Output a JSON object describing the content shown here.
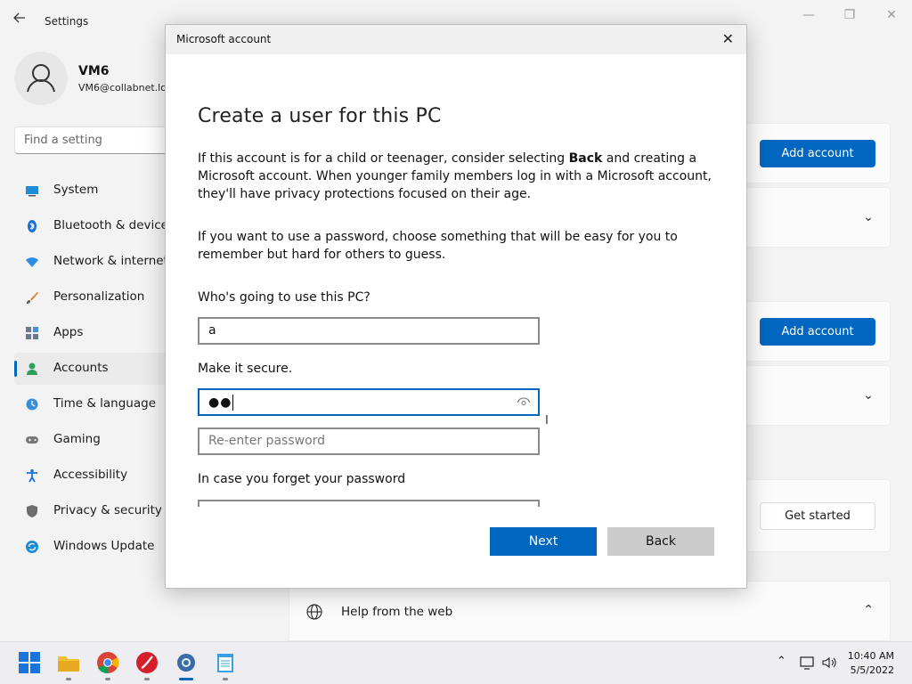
{
  "settings": {
    "title": "Settings",
    "profile": {
      "name": "VM6",
      "email": "VM6@collabnet.lo"
    },
    "search_placeholder": "Find a setting",
    "nav": [
      {
        "label": "System",
        "icon": "system-icon"
      },
      {
        "label": "Bluetooth & devices",
        "icon": "bluetooth-icon"
      },
      {
        "label": "Network & internet",
        "icon": "wifi-icon"
      },
      {
        "label": "Personalization",
        "icon": "brush-icon"
      },
      {
        "label": "Apps",
        "icon": "apps-icon"
      },
      {
        "label": "Accounts",
        "icon": "accounts-icon",
        "active": true
      },
      {
        "label": "Time & language",
        "icon": "clock-icon"
      },
      {
        "label": "Gaming",
        "icon": "gamepad-icon"
      },
      {
        "label": "Accessibility",
        "icon": "accessibility-icon"
      },
      {
        "label": "Privacy & security",
        "icon": "shield-icon"
      },
      {
        "label": "Windows Update",
        "icon": "update-icon"
      }
    ],
    "add_account_label": "Add account",
    "get_started_label": "Get started",
    "help_label": "Help from the web"
  },
  "dialog": {
    "title": "Microsoft account",
    "heading": "Create a user for this PC",
    "para1_before": "If this account is for a child or teenager, consider selecting ",
    "para1_bold": "Back",
    "para1_after": " and creating a Microsoft account. When younger family members log in with a Microsoft account, they'll have privacy protections focused on their age.",
    "para2": "If you want to use a password, choose something that will be easy for you to remember but hard for others to guess.",
    "who_label": "Who's going to use this PC?",
    "who_value": "a",
    "secure_label": "Make it secure.",
    "password_dots": "●●",
    "reenter_placeholder": "Re-enter password",
    "forget_label": "In case you forget your password",
    "next_label": "Next",
    "back_label": "Back"
  },
  "taskbar": {
    "time": "10:40 AM",
    "date": "5/5/2022"
  },
  "colors": {
    "accent": "#0067c0"
  }
}
